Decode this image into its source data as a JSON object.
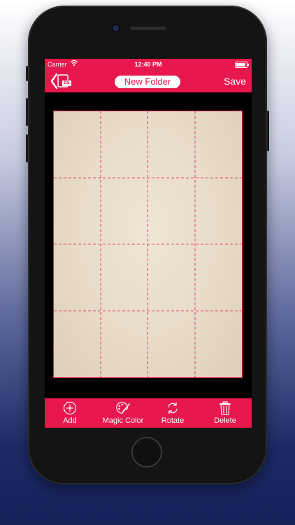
{
  "status_bar": {
    "carrier": "Carrier",
    "time": "12:40 PM"
  },
  "navbar": {
    "folder_label": "New Folder",
    "save_label": "Save",
    "back_badge": "DS"
  },
  "toolbar": {
    "items": [
      {
        "label": "Add",
        "icon": "plus-circle-icon"
      },
      {
        "label": "Magic Color",
        "icon": "palette-icon"
      },
      {
        "label": "Rotate",
        "icon": "rotate-icon"
      },
      {
        "label": "Delete",
        "icon": "trash-icon"
      }
    ]
  },
  "colors": {
    "accent": "#e8174d",
    "paper": "#e9dece",
    "grid_line": "#e8174d"
  }
}
